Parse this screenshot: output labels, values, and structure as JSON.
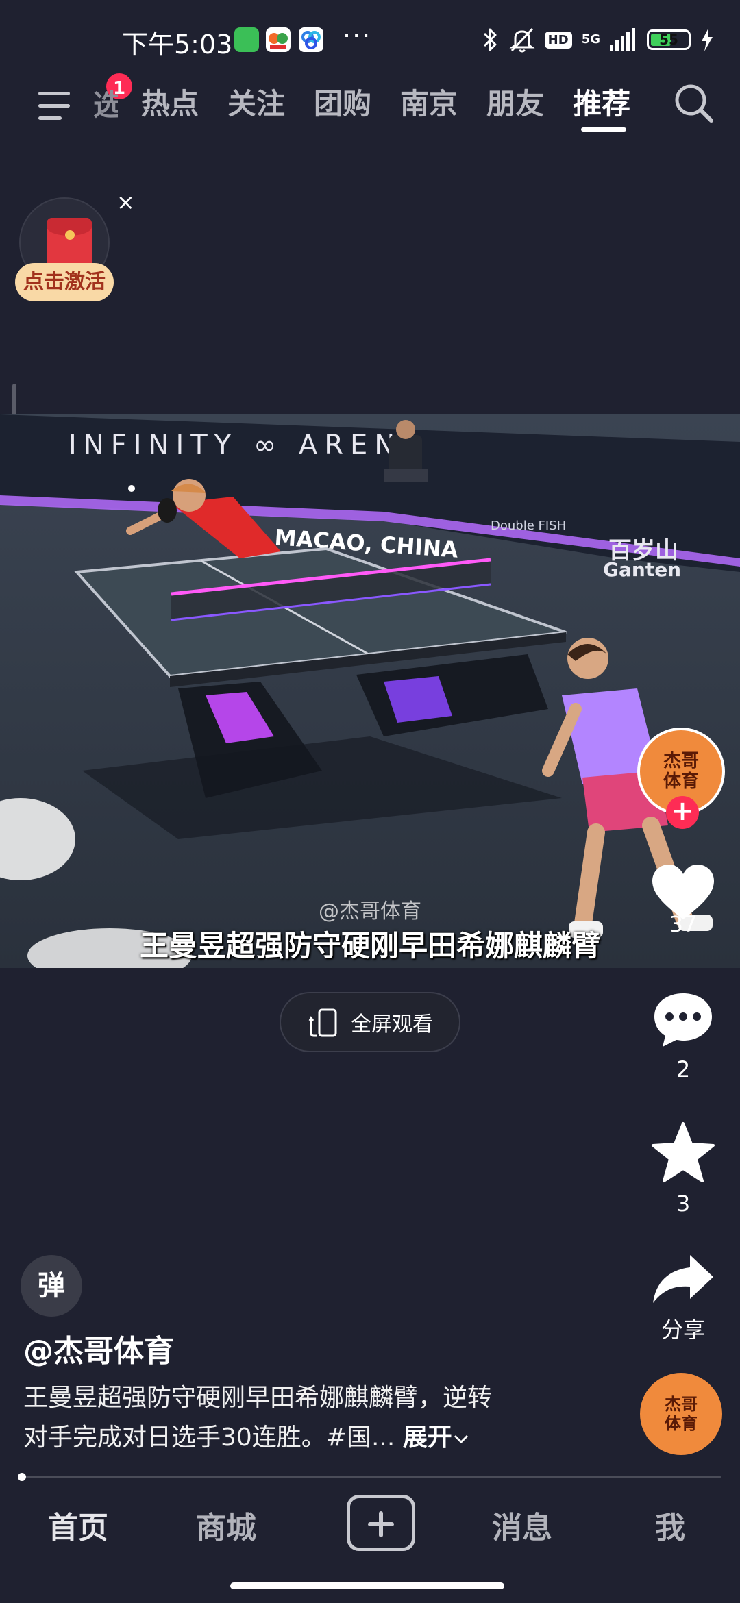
{
  "status_bar": {
    "time": "下午5:03",
    "dots": "···",
    "network": "5G",
    "hd": "HD",
    "battery": "55",
    "battery_level": 0.55
  },
  "top_nav": {
    "menu_badge": "1",
    "partial_tab": "选",
    "tabs": [
      "热点",
      "关注",
      "团购",
      "南京",
      "朋友",
      "推荐"
    ],
    "active_tab": "推荐"
  },
  "red_packet": {
    "label": "点击激活",
    "close": "×"
  },
  "video": {
    "watermark": "@杰哥体育",
    "caption": "王曼昱超强防守硬刚早田希娜麒麟臂",
    "scene_text": {
      "arena": "INFINITY ∞ ARENA",
      "venue": "MACAO, CHINA",
      "sponsor1": "百岁山",
      "sponsor2": "Ganten",
      "sponsor3": "Double FISH"
    }
  },
  "right_rail": {
    "avatar_text": "杰哥\n体育",
    "follow": "+",
    "likes": "37",
    "comments": "2",
    "favorites": "3",
    "share": "分享",
    "music_text": "杰哥\n体育"
  },
  "fullscreen": {
    "label": "全屏观看"
  },
  "danmu": {
    "label": "弹"
  },
  "post": {
    "author": "@杰哥体育",
    "desc_line1": "王曼昱超强防守硬刚早田希娜麒麟臂，逆转",
    "desc_line2": "对手完成对日选手30连胜。#国...",
    "expand": "展开"
  },
  "progress": 0.0,
  "bottom_nav": {
    "home": "首页",
    "mall": "商城",
    "messages": "消息",
    "me": "我"
  },
  "colors": {
    "background": "#1f2130",
    "accent": "#fe2c55",
    "avatar": "#f08a3c",
    "battery": "#3fd05a"
  }
}
